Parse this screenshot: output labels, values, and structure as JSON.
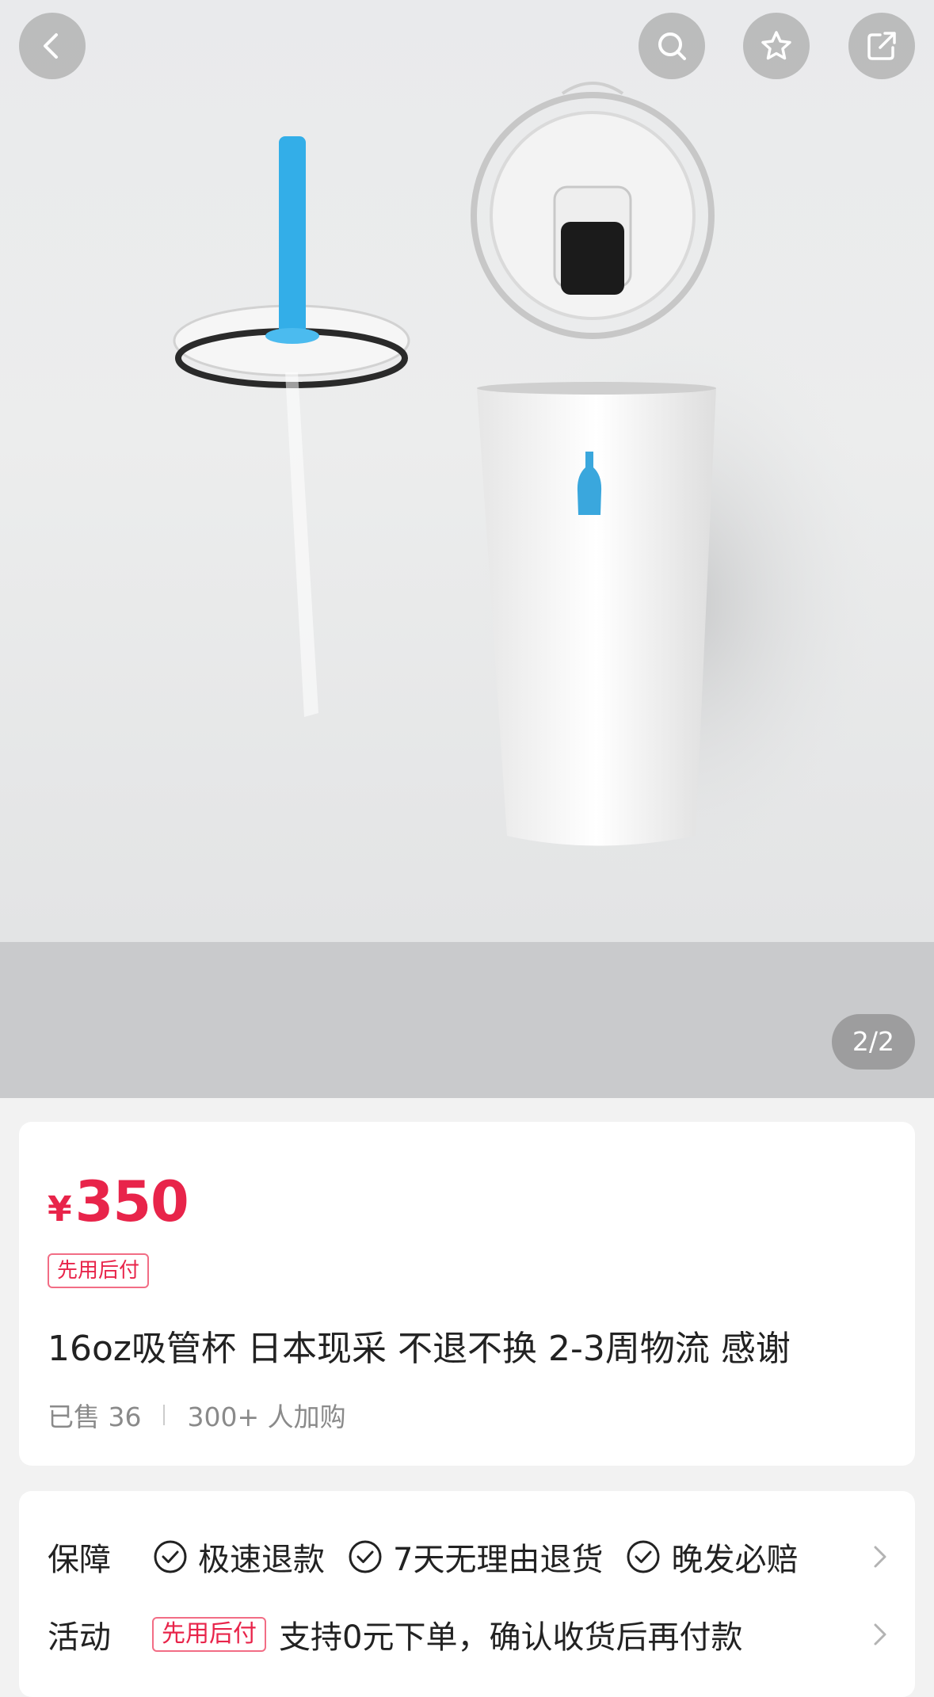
{
  "gallery": {
    "counter": "2/2"
  },
  "nav": {
    "icons": [
      "back-icon",
      "search-icon",
      "star-icon",
      "share-icon"
    ]
  },
  "product": {
    "currency": "¥",
    "price": "350",
    "badge": "先用后付",
    "title": "16oz吸管杯 日本现采 不退不换 2-3周物流 感谢",
    "sold": "已售 36",
    "carted": "300+ 人加购"
  },
  "services": {
    "guarantee_label": "保障",
    "guarantees": [
      "极速退款",
      "7天无理由退货",
      "晚发必赔"
    ],
    "activity_label": "活动",
    "activity_tag": "先用后付",
    "activity_text": "支持0元下单，确认收货后再付款"
  },
  "colors": {
    "accent": "#e8244a",
    "straw": "#33aee8"
  }
}
